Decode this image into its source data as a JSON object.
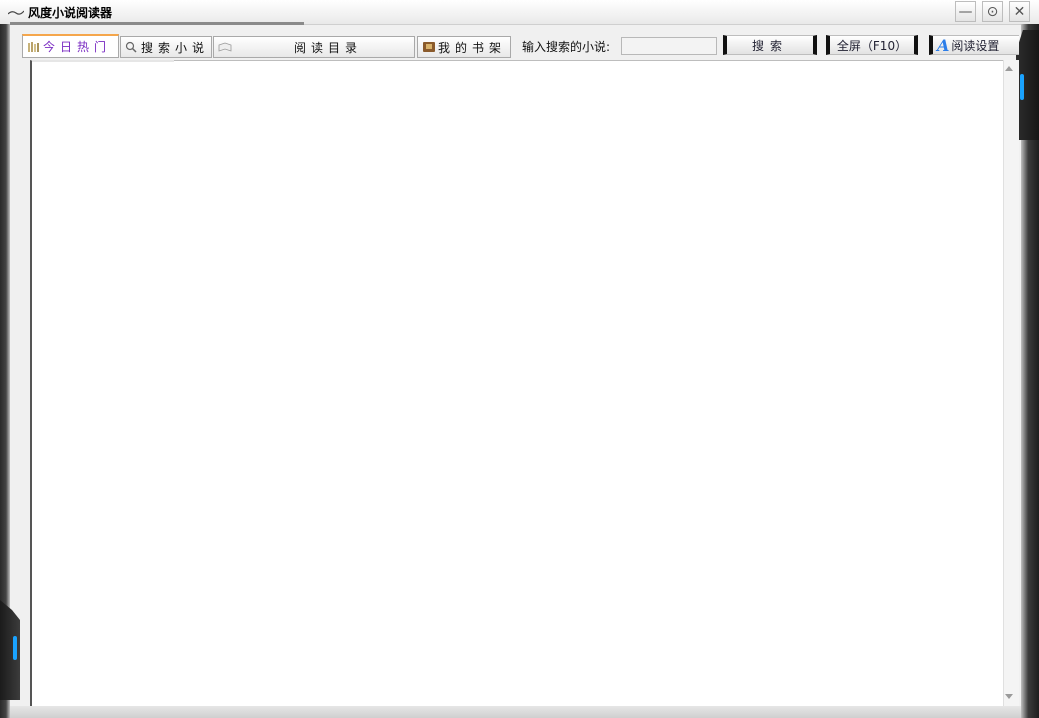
{
  "window": {
    "title": "风度小说阅读器",
    "controls": {
      "minimize": "—",
      "settings": "⊙",
      "close": "✕"
    }
  },
  "tabs": [
    {
      "label": "今日热门",
      "icon": "bookshelf-icon",
      "active": true
    },
    {
      "label": "搜索小说",
      "icon": "magnifier-icon",
      "active": false
    },
    {
      "label": "阅读目录",
      "icon": "open-book-icon",
      "active": false
    },
    {
      "label": "我的书架",
      "icon": "book-icon",
      "active": false
    }
  ],
  "search": {
    "label": "输入搜索的小说:",
    "value": "",
    "button_label": "搜索"
  },
  "toolbar": {
    "fullscreen_label": "全屏（F10）",
    "settings_label": "阅读设置",
    "settings_icon_letter": "A"
  },
  "colors": {
    "accent_blue": "#1aa3ff",
    "active_tab_text": "#7a2cc2",
    "active_tab_top": "#f5a64b",
    "frame_dark": "#1e1e1e"
  }
}
